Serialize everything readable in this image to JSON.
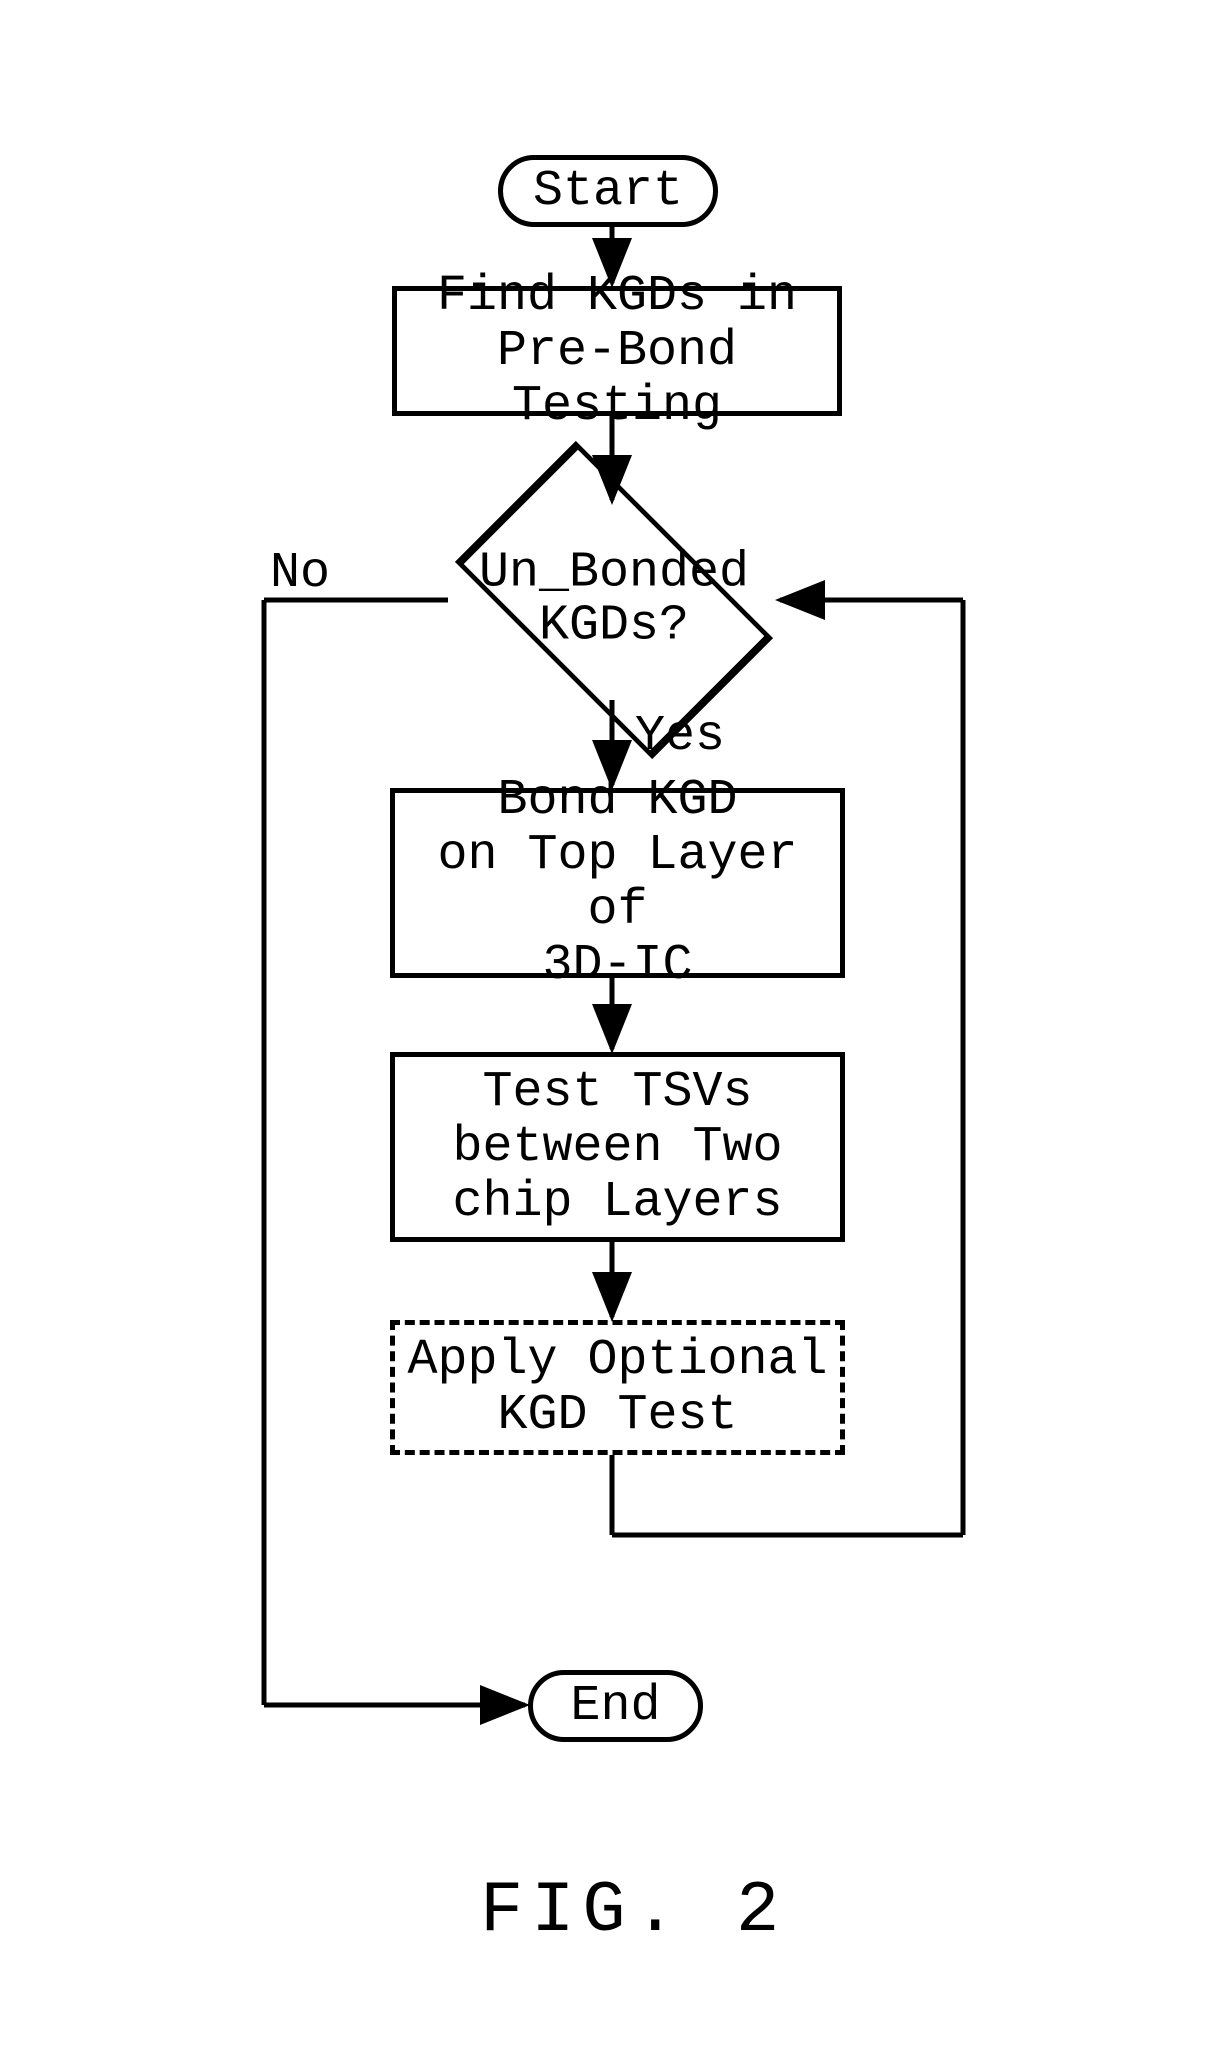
{
  "chart_data": {
    "type": "flowchart",
    "title": "FIG. 2",
    "nodes": [
      {
        "id": "start",
        "shape": "terminal",
        "text": "Start"
      },
      {
        "id": "find",
        "shape": "process",
        "text": "Find KGDs in\nPre-Bond Testing"
      },
      {
        "id": "dec",
        "shape": "decision",
        "text": "Un_Bonded\nKGDs?"
      },
      {
        "id": "bond",
        "shape": "process",
        "text": "Bond KGD\non Top Layer of\n3D-IC"
      },
      {
        "id": "test",
        "shape": "process",
        "text": "Test TSVs\nbetween Two\nchip Layers"
      },
      {
        "id": "opt",
        "shape": "process-dashed",
        "text": "Apply Optional\nKGD Test"
      },
      {
        "id": "end",
        "shape": "terminal",
        "text": "End"
      }
    ],
    "edges": [
      {
        "from": "start",
        "to": "find"
      },
      {
        "from": "find",
        "to": "dec"
      },
      {
        "from": "dec",
        "to": "bond",
        "label": "Yes"
      },
      {
        "from": "dec",
        "to": "end",
        "label": "No",
        "routing": "left-down"
      },
      {
        "from": "bond",
        "to": "test"
      },
      {
        "from": "test",
        "to": "opt"
      },
      {
        "from": "opt",
        "to": "dec",
        "routing": "right-up-loop"
      }
    ]
  },
  "terminals": {
    "start": "Start",
    "end": "End"
  },
  "processes": {
    "find": "Find KGDs in\nPre-Bond Testing",
    "bond": "Bond KGD\non Top Layer of\n3D-IC",
    "test": "Test TSVs\nbetween Two\nchip Layers",
    "opt": "Apply Optional\nKGD Test"
  },
  "decision": {
    "text": "Un_Bonded\nKGDs?"
  },
  "labels": {
    "no": "No",
    "yes": "Yes"
  },
  "caption": "FIG. 2"
}
